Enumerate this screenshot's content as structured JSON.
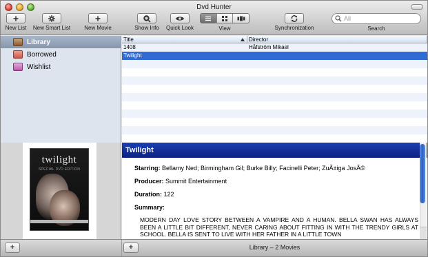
{
  "window": {
    "title": "Dvd Hunter"
  },
  "toolbar": {
    "new_list": "New List",
    "new_smart_list": "New Smart List",
    "new_movie": "New Movie",
    "show_info": "Show Info",
    "quick_look": "Quick Look",
    "view": "View",
    "synchronization": "Synchronization",
    "search_label": "Search",
    "search_placeholder": "All",
    "view_selected": "list"
  },
  "sidebar": {
    "items": [
      {
        "label": "Library",
        "icon": "library-icon",
        "selected": true
      },
      {
        "label": "Borrowed",
        "icon": "borrowed-icon",
        "selected": false
      },
      {
        "label": "Wishlist",
        "icon": "wishlist-icon",
        "selected": false
      }
    ]
  },
  "table": {
    "columns": [
      "Title",
      "Director"
    ],
    "sort_column": "Title",
    "rows": [
      {
        "title": "1408",
        "director": "Håfström Mikael",
        "selected": false
      },
      {
        "title": "Twilight",
        "director": "",
        "selected": true
      }
    ]
  },
  "cover": {
    "title": "twilight",
    "subtitle": "SPECIAL DVD EDITION"
  },
  "detail": {
    "heading": "Twilight",
    "starring_label": "Starring:",
    "starring_value": "Bellamy Ned; Birmingham Gil; Burke Billy; Facinelli Peter; ZuÃ±iga JosÃ©",
    "producer_label": "Producer:",
    "producer_value": "Summit Entertainment",
    "duration_label": "Duration:",
    "duration_value": "122",
    "summary_label": "Summary:",
    "summary_text": "MODERN DAY LOVE STORY BETWEEN A VAMPIRE AND A HUMAN. BELLA SWAN HAS ALWAYS BEEN A LITTLE BIT DIFFERENT, NEVER CARING ABOUT FITTING IN WITH THE TRENDY GIRLS AT SCHOOL. BELLA IS SENT TO LIVE WITH HER FATHER IN A LITTLE TOWN"
  },
  "bottombar": {
    "add_list_label": "+",
    "add_movie_label": "+",
    "status": "Library – 2 Movies"
  },
  "colors": {
    "selection": "#2f6bd3",
    "detail_header": "#0c2284",
    "sidebar_bg": "#dde4ee"
  }
}
